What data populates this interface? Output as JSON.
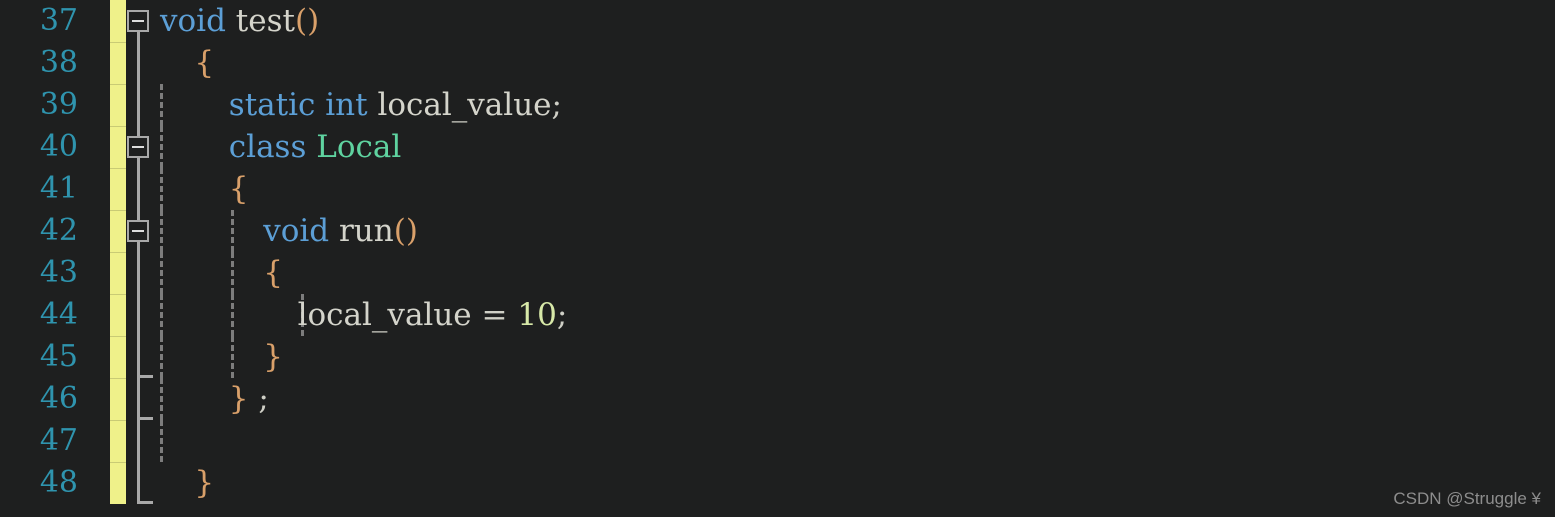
{
  "editor": {
    "background_color": "#1e1f1f",
    "line_number_color": "#2f94ae",
    "change_bar_color": "#eff18a",
    "first_visible_line": 37,
    "line_height_px": 42
  },
  "watermark": {
    "text": "CSDN @Struggle ¥"
  },
  "lines": [
    {
      "number": "37",
      "text": "void test()",
      "fold": "open",
      "guides": 0,
      "indent": 0,
      "tokens": [
        {
          "t": "void",
          "c": "kw"
        },
        {
          "t": " ",
          "c": "id"
        },
        {
          "t": "test",
          "c": "id"
        },
        {
          "t": "()",
          "c": "br"
        }
      ]
    },
    {
      "number": "38",
      "text": "{",
      "fold": "line",
      "guides": 0,
      "indent": 1,
      "tokens": [
        {
          "t": "{",
          "c": "br"
        }
      ]
    },
    {
      "number": "39",
      "text": "    static int local_value;",
      "fold": "line",
      "guides": 1,
      "indent": 2,
      "tokens": [
        {
          "t": "static",
          "c": "kw"
        },
        {
          "t": " ",
          "c": "id"
        },
        {
          "t": "int",
          "c": "kw"
        },
        {
          "t": " ",
          "c": "id"
        },
        {
          "t": "local_value",
          "c": "id"
        },
        {
          "t": ";",
          "c": "pun"
        }
      ]
    },
    {
      "number": "40",
      "text": "    class Local",
      "fold": "open",
      "guides": 1,
      "indent": 2,
      "tokens": [
        {
          "t": "class",
          "c": "kw"
        },
        {
          "t": " ",
          "c": "id"
        },
        {
          "t": "Local",
          "c": "typ"
        }
      ]
    },
    {
      "number": "41",
      "text": "    {",
      "fold": "line",
      "guides": 1,
      "indent": 2,
      "tokens": [
        {
          "t": "{",
          "c": "br"
        }
      ]
    },
    {
      "number": "42",
      "text": "        void run()",
      "fold": "open",
      "guides": 2,
      "indent": 3,
      "tokens": [
        {
          "t": "void",
          "c": "kw"
        },
        {
          "t": " ",
          "c": "id"
        },
        {
          "t": "run",
          "c": "id"
        },
        {
          "t": "()",
          "c": "br"
        }
      ]
    },
    {
      "number": "43",
      "text": "        {",
      "fold": "line",
      "guides": 2,
      "indent": 3,
      "tokens": [
        {
          "t": "{",
          "c": "br"
        }
      ]
    },
    {
      "number": "44",
      "text": "            local_value = 10;",
      "fold": "line",
      "guides": 3,
      "indent": 4,
      "tokens": [
        {
          "t": "local_value",
          "c": "id"
        },
        {
          "t": " ",
          "c": "id"
        },
        {
          "t": "=",
          "c": "pun"
        },
        {
          "t": " ",
          "c": "id"
        },
        {
          "t": "10",
          "c": "num"
        },
        {
          "t": ";",
          "c": "pun"
        }
      ]
    },
    {
      "number": "45",
      "text": "        }",
      "fold": "end-inner",
      "guides": 2,
      "indent": 3,
      "tokens": [
        {
          "t": "}",
          "c": "br"
        }
      ]
    },
    {
      "number": "46",
      "text": "    };",
      "fold": "end-mid",
      "guides": 1,
      "indent": 2,
      "tokens": [
        {
          "t": "}",
          "c": "br"
        },
        {
          "t": " ",
          "c": "id"
        },
        {
          "t": ";",
          "c": "pun"
        }
      ]
    },
    {
      "number": "47",
      "text": "",
      "fold": "line",
      "guides": 1,
      "indent": 0,
      "tokens": []
    },
    {
      "number": "48",
      "text": "}",
      "fold": "end-outer",
      "guides": 0,
      "indent": 1,
      "tokens": [
        {
          "t": "}",
          "c": "br"
        }
      ]
    }
  ]
}
